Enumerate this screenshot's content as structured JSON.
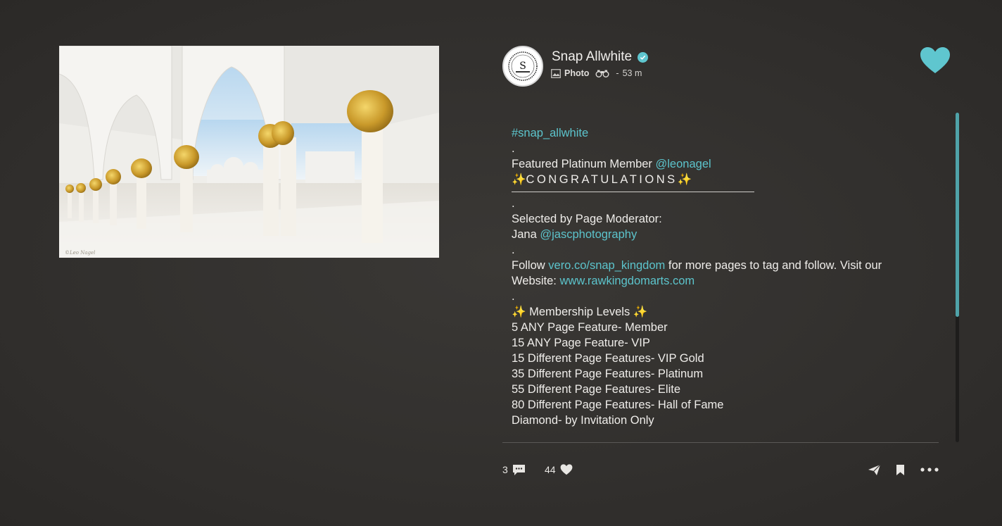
{
  "post": {
    "author_name": "Snap Allwhite",
    "avatar_text": "S",
    "post_type": "Photo",
    "separator": "-",
    "time_ago": "53 m",
    "liked_color": "#5fc6cf"
  },
  "caption": {
    "hashtag": "#snap_allwhite",
    "dot1": ".",
    "featured_prefix": "Featured Platinum Member ",
    "featured_handle": "@leonagel",
    "congrats_sparkle_left": "✨",
    "congrats_text": "CONGRATULATIONS",
    "congrats_sparkle_right": "✨",
    "dot2": ".",
    "selected_by": "Selected by Page Moderator:",
    "moderator_name": "Jana ",
    "moderator_handle": "@jascphotography",
    "dot3": ".",
    "follow_prefix": "Follow ",
    "follow_link": "vero.co/snap_kingdom",
    "follow_suffix": " for more pages to tag and follow. Visit our",
    "website_prefix": "Website: ",
    "website_link": "www.rawkingdomarts.com",
    "dot4": ".",
    "membership_sparkle_left": "✨",
    "membership_title": " Membership Levels ",
    "membership_sparkle_right": "✨",
    "levels": [
      "5  ANY Page Feature- Member",
      "15 ANY Page Feature- VIP",
      "15 Different Page Features- VIP Gold",
      "35 Different Page Features- Platinum",
      "55 Different Page Features- Elite",
      "80 Different Page Features- Hall of Fame",
      "Diamond- by Invitation Only"
    ]
  },
  "actions": {
    "comment_count": "3",
    "like_count": "44"
  }
}
